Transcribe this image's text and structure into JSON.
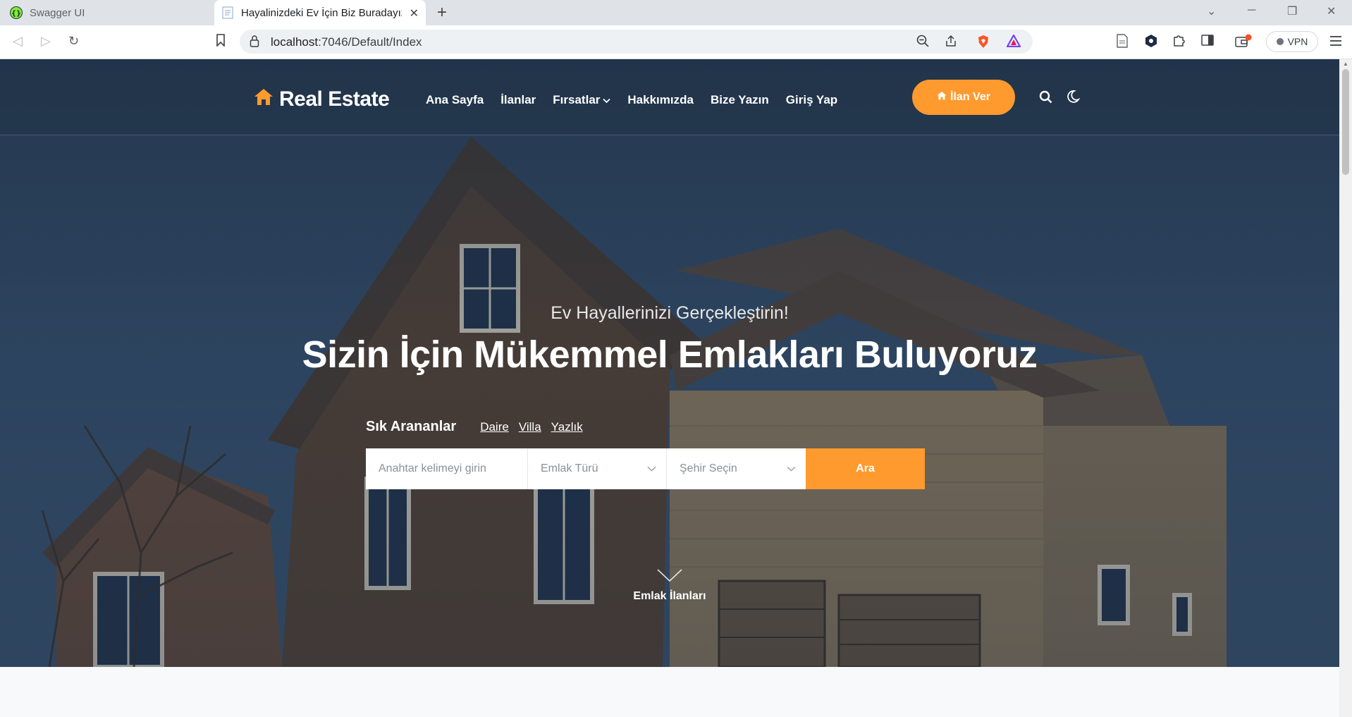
{
  "browser": {
    "tabs": [
      {
        "title": "Swagger UI",
        "icon": "swagger-icon",
        "active": false
      },
      {
        "title": "Hayalinizdeki Ev İçin Biz Buradayız",
        "icon": "page-icon",
        "active": true
      }
    ],
    "url_host": "localhost",
    "url_path": ":7046/Default/Index",
    "vpn_label": "VPN"
  },
  "site": {
    "logo": "Real Estate",
    "menu": [
      {
        "label": "Ana Sayfa",
        "has_dropdown": false
      },
      {
        "label": "İlanlar",
        "has_dropdown": false
      },
      {
        "label": "Fırsatlar",
        "has_dropdown": true
      },
      {
        "label": "Hakkımızda",
        "has_dropdown": false
      },
      {
        "label": "Bize Yazın",
        "has_dropdown": false
      },
      {
        "label": "Giriş Yap",
        "has_dropdown": false
      }
    ],
    "cta_label": "İlan Ver",
    "accent_color": "#ff9a2e"
  },
  "hero": {
    "subtitle": "Ev Hayallerinizi Gerçekleştirin!",
    "title": "Sizin İçin Mükemmel Emlakları Buluyoruz",
    "popular_label": "Sık Arananlar",
    "popular_links": [
      "Daire",
      "Villa",
      "Yazlık"
    ],
    "search": {
      "keyword_placeholder": "Anahtar kelimeyi girin",
      "type_placeholder": "Emlak Türü",
      "city_placeholder": "Şehir Seçin",
      "button_label": "Ara"
    },
    "scroll_label": "Emlak İlanları"
  }
}
